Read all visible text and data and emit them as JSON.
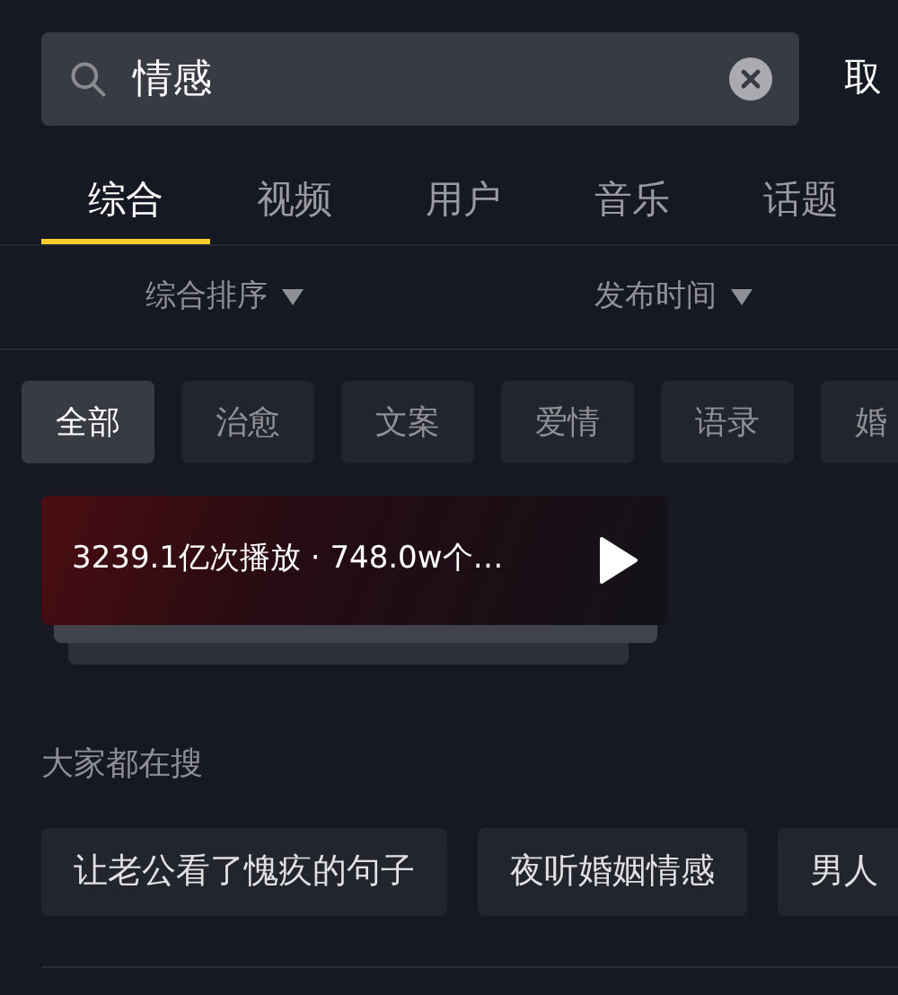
{
  "search": {
    "value": "情感",
    "cancel": "取"
  },
  "tabs": [
    {
      "label": "综合",
      "selected": true
    },
    {
      "label": "视频",
      "selected": false
    },
    {
      "label": "用户",
      "selected": false
    },
    {
      "label": "音乐",
      "selected": false
    },
    {
      "label": "话题",
      "selected": false
    }
  ],
  "sort": [
    "综合排序",
    "发布时间"
  ],
  "filters": [
    {
      "label": "全部",
      "selected": true
    },
    {
      "label": "治愈",
      "selected": false
    },
    {
      "label": "文案",
      "selected": false
    },
    {
      "label": "爱情",
      "selected": false
    },
    {
      "label": "语录",
      "selected": false
    },
    {
      "label": "婚",
      "selected": false
    }
  ],
  "topic_card": {
    "stats": "3239.1亿次播放 · 748.0w个…"
  },
  "popular": {
    "title": "大家都在搜",
    "items": [
      "让老公看了愧疚的句子",
      "夜听婚姻情感",
      "男人"
    ]
  }
}
